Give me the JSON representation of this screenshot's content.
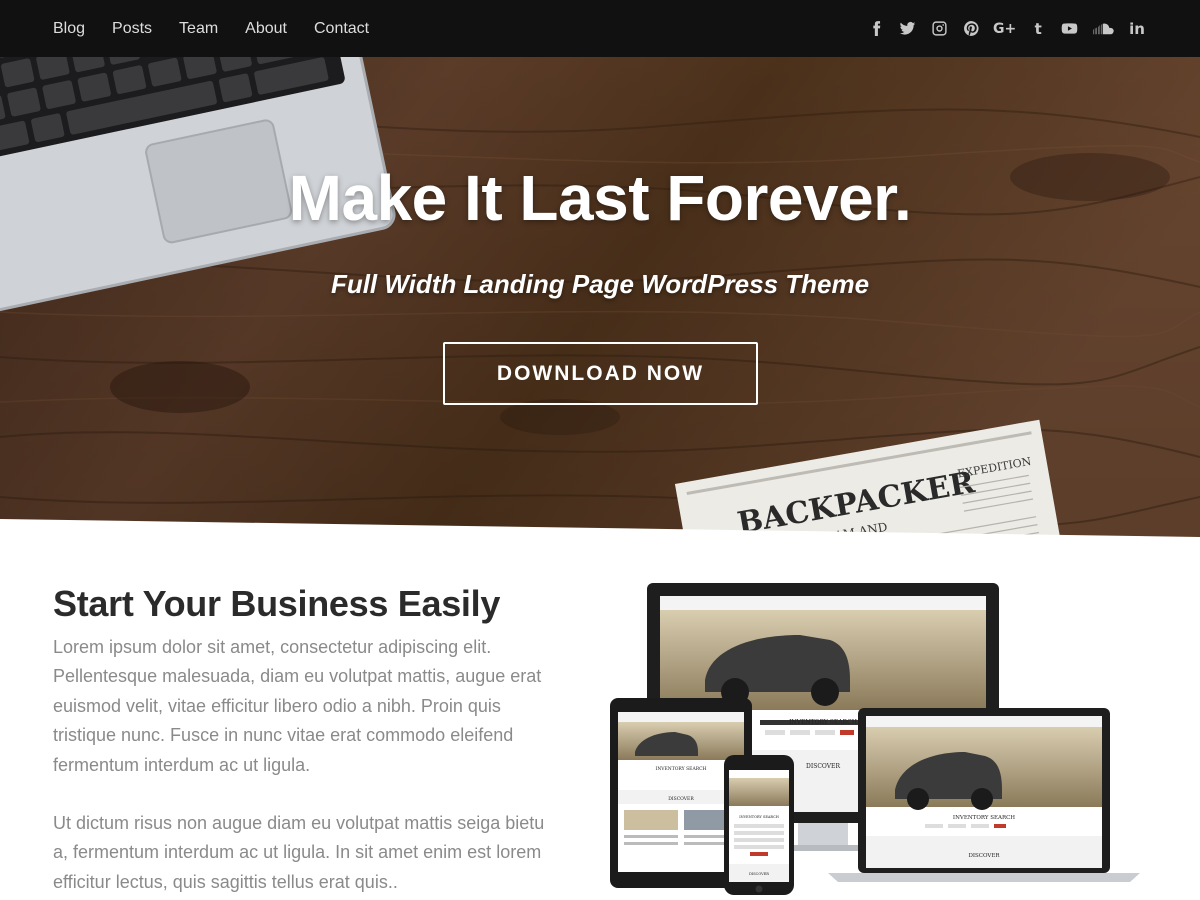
{
  "nav": {
    "links": [
      "Blog",
      "Posts",
      "Team",
      "About",
      "Contact"
    ],
    "social": [
      "facebook-icon",
      "twitter-icon",
      "instagram-icon",
      "pinterest-icon",
      "google-plus-icon",
      "tumblr-icon",
      "youtube-icon",
      "soundcloud-icon",
      "linkedin-icon"
    ]
  },
  "hero": {
    "title": "Make It Last Forever.",
    "subtitle": "Full Width Landing Page WordPress Theme",
    "button": "DOWNLOAD NOW",
    "newspaper_title": "BACKPACKER",
    "newspaper_tag": "YOUR DREAM AND",
    "newspaper_side": "EXPEDITION"
  },
  "content": {
    "heading": "Start Your Business Easily",
    "paragraph1": "Lorem ipsum dolor sit amet, consectetur adipiscing elit. Pellentesque malesuada, diam eu volutpat mattis, augue erat euismod velit, vitae efficitur libero odio a nibh. Proin quis tristique nunc. Fusce in nunc vitae erat commodo eleifend fermentum interdum ac ut ligula.",
    "paragraph2": "Ut dictum risus non augue diam eu volutpat mattis seiga bietu a, fermentum interdum ac ut ligula. In sit amet enim est lorem efficitur lectus, quis sagittis tellus erat quis.."
  },
  "mockup": {
    "inventory": "INVENTORY SEARCH",
    "discover": "DISCOVER"
  },
  "colors": {
    "nav_bg": "#111111",
    "wood": "#5a3a24",
    "heading": "#2b2b2b",
    "body_text": "#8a8a8a"
  }
}
